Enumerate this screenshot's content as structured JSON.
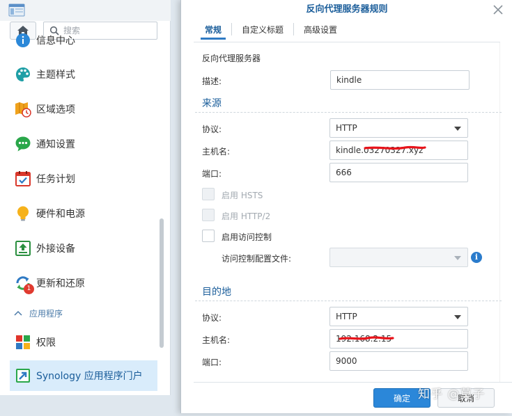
{
  "window": {
    "search_placeholder": "搜索"
  },
  "sidebar": {
    "items": [
      {
        "label": "信息中心",
        "icon": "info-center-icon"
      },
      {
        "label": "主题样式",
        "icon": "theme-palette-icon"
      },
      {
        "label": "区域选项",
        "icon": "regional-options-icon"
      },
      {
        "label": "通知设置",
        "icon": "notification-chat-icon"
      },
      {
        "label": "任务计划",
        "icon": "task-scheduler-icon"
      },
      {
        "label": "硬件和电源",
        "icon": "hardware-power-bulb-icon"
      },
      {
        "label": "外接设备",
        "icon": "external-devices-icon"
      },
      {
        "label": "更新和还原",
        "icon": "update-restore-icon",
        "badge": "1"
      },
      {
        "label": "权限",
        "icon": "privileges-icon"
      },
      {
        "label": "Synology 应用程序门户",
        "icon": "application-portal-icon",
        "active": true
      }
    ],
    "section_apps": "应用程序"
  },
  "dialog": {
    "title": "反向代理服务器规则",
    "tabs": [
      {
        "label": "常规",
        "active": true
      },
      {
        "label": "自定义标题"
      },
      {
        "label": "高级设置"
      }
    ],
    "section_reverse_proxy": "反向代理服务器",
    "description_label": "描述:",
    "description_value": "kindle",
    "source": {
      "title": "来源",
      "protocol_label": "协议:",
      "protocol_value": "HTTP",
      "hostname_label": "主机名:",
      "hostname_value": "kindle.03270327.xyz",
      "port_label": "端口:",
      "port_value": "666",
      "hsts_label": "启用 HSTS",
      "http2_label": "启用 HTTP/2",
      "access_control_label": "启用访问控制",
      "access_profile_label": "访问控制配置文件:",
      "access_profile_value": ""
    },
    "destination": {
      "title": "目的地",
      "protocol_label": "协议:",
      "protocol_value": "HTTP",
      "hostname_label": "主机名:",
      "hostname_value": "192.168.2.15",
      "port_label": "端口:",
      "port_value": "9000"
    },
    "ok_label": "确定",
    "cancel_label": "取消",
    "watermark": "知乎 @莫子"
  },
  "colors": {
    "accent": "#1a5d9a",
    "primary_button": "#2b87d9",
    "active_nav_bg": "#d9ecfb",
    "redaction": "#e8141b"
  }
}
